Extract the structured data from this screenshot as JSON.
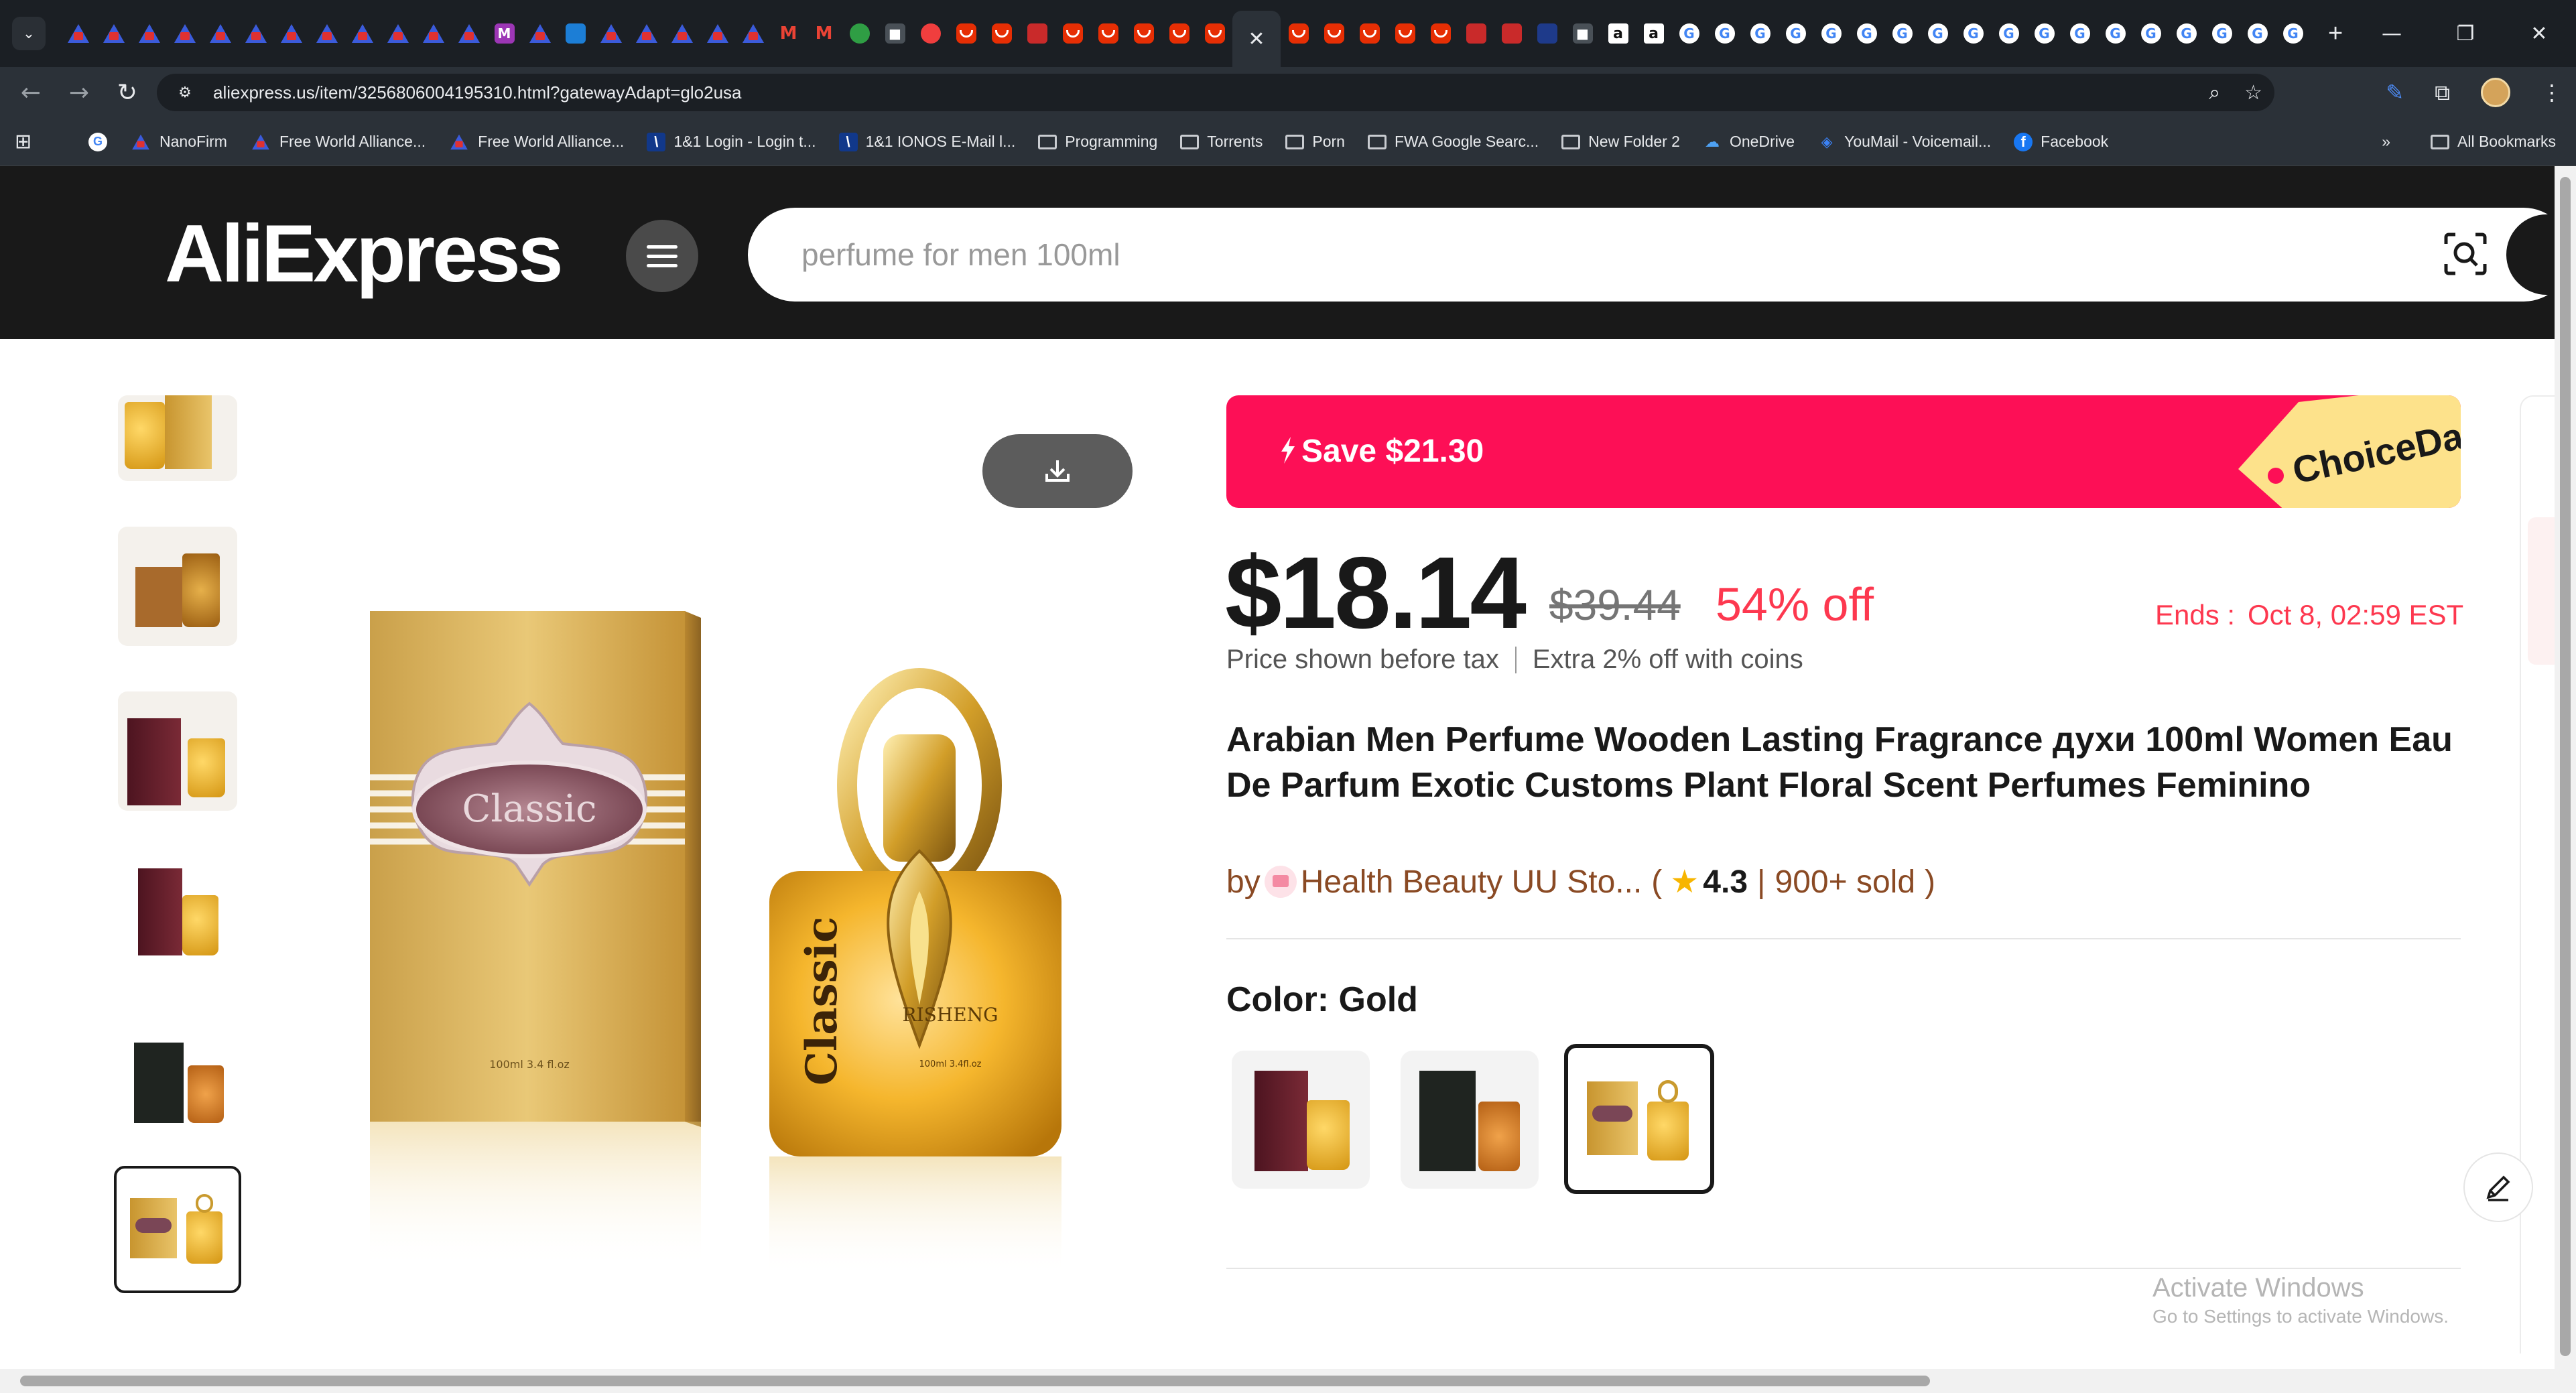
{
  "browser": {
    "url": "aliexpress.us/item/3256806004195310.html?gatewayAdapt=glo2usa",
    "tabs_icons": [
      "tri",
      "tri",
      "tri",
      "tri",
      "tri",
      "tri",
      "tri",
      "tri",
      "tri",
      "tri",
      "tri",
      "tri",
      "purple",
      "tri",
      "blue",
      "tri",
      "tri",
      "tri",
      "tri",
      "tri",
      "gmail",
      "gmail",
      "green",
      "dark",
      "ytr",
      "ali",
      "ali",
      "store",
      "ali",
      "ali",
      "ali",
      "ali",
      "ali",
      "active",
      "ali",
      "ali",
      "ali",
      "ali",
      "ali",
      "store",
      "store",
      "navy",
      "dark",
      "amz",
      "amz",
      "google",
      "google",
      "google",
      "google",
      "google",
      "google",
      "google",
      "google",
      "google",
      "google",
      "google",
      "google",
      "google",
      "google",
      "google",
      "google",
      "google",
      "google"
    ],
    "tab_glyphs": {
      "gmail": "M",
      "amz": "a",
      "google": "G",
      "purple": "M",
      "dark": "■"
    },
    "bookmarks": [
      {
        "icon": "google",
        "glyph": "G",
        "label": ""
      },
      {
        "icon": "tri",
        "glyph": "",
        "label": "NanoFirm"
      },
      {
        "icon": "tri",
        "glyph": "",
        "label": "Free World Alliance..."
      },
      {
        "icon": "tri",
        "glyph": "",
        "label": "Free World Alliance..."
      },
      {
        "icon": "ionos",
        "glyph": "\\",
        "label": "1&1 Login - Login t..."
      },
      {
        "icon": "ionos",
        "glyph": "\\",
        "label": "1&1 IONOS E-Mail l..."
      },
      {
        "icon": "folder",
        "glyph": "",
        "label": "Programming"
      },
      {
        "icon": "folder",
        "glyph": "",
        "label": "Torrents"
      },
      {
        "icon": "folder",
        "glyph": "",
        "label": "Porn"
      },
      {
        "icon": "folder",
        "glyph": "",
        "label": "FWA Google Searc..."
      },
      {
        "icon": "folder",
        "glyph": "",
        "label": "New Folder 2"
      },
      {
        "icon": "cloud",
        "glyph": "☁",
        "label": "OneDrive"
      },
      {
        "icon": "youmail",
        "glyph": "◈",
        "label": "YouMail - Voicemail..."
      },
      {
        "icon": "facebook",
        "glyph": "f",
        "label": "Facebook"
      }
    ],
    "bookmarks_overflow": "»",
    "all_bookmarks": "All Bookmarks"
  },
  "header": {
    "logo": "AliExpress",
    "search_placeholder": "perfume for men 100ml"
  },
  "product": {
    "promo": {
      "save": "Save $21.30",
      "badge": "ChoiceDay"
    },
    "price": "$18.14",
    "original_price": "$39.44",
    "discount": "54% off",
    "ends_label": "Ends :",
    "ends_date": "Oct 8, 02:59 EST",
    "tax_note": "Price shown before tax",
    "coins_note": "Extra 2% off with coins",
    "title": "Arabian Men Perfume Wooden Lasting Fragrance духи 100ml Women Eau De Parfum Exotic Customs Plant Floral Scent Perfumes Feminino",
    "store_prefix": "by",
    "store_name": "Health Beauty UU Sto...",
    "rating": "4.3",
    "sold": "900+ sold",
    "color_label": "Color: Gold",
    "main_image": {
      "box_label": "Classic",
      "box_volume": "100ml  3.4 fl.oz",
      "bottle_label": "Classic",
      "bottle_brand": "RISHENG",
      "bottle_volume": "100ml  3.4fl.oz"
    }
  },
  "system": {
    "activate_title": "Activate Windows",
    "activate_sub": "Go to Settings to activate Windows."
  },
  "colors": {
    "accent": "#fd0f56",
    "price_red": "#fd384f",
    "header_bg": "#191919",
    "store_brown": "#8a4a24"
  }
}
